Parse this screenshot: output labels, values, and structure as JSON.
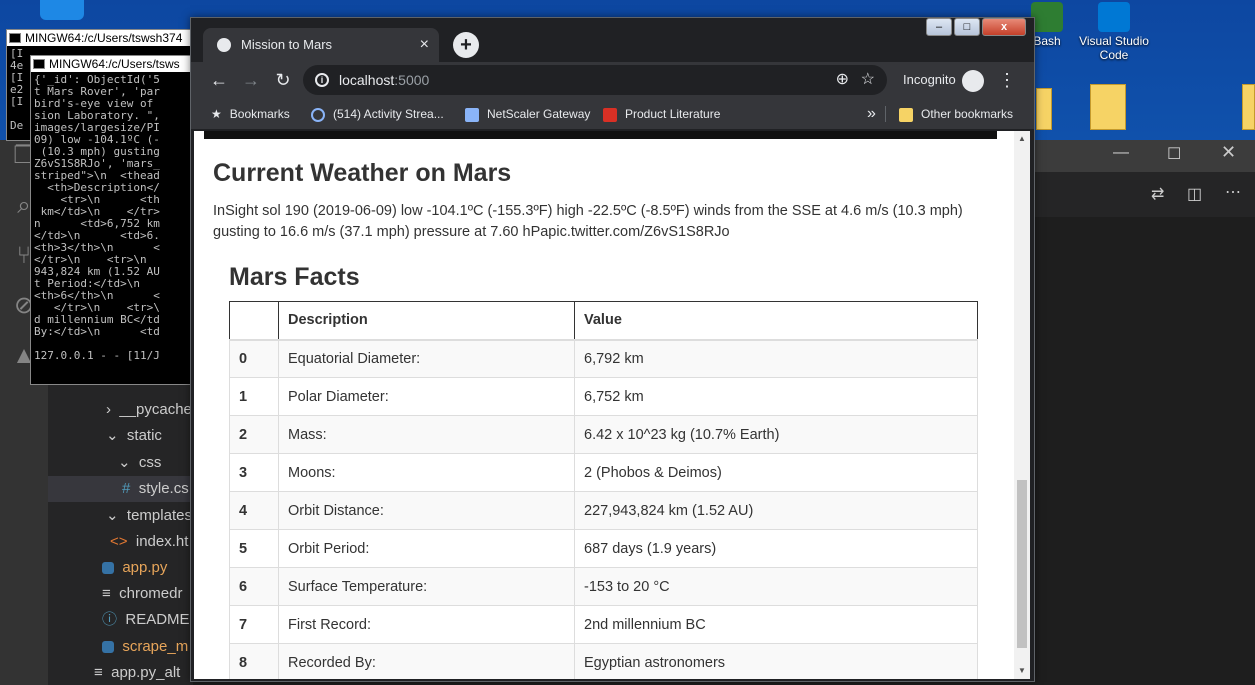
{
  "desktop": {
    "icons": [
      {
        "label": "Bash"
      },
      {
        "label": "Visual Studio Code"
      }
    ]
  },
  "terminals": {
    "back_title": "MINGW64:/c/Users/tswsh374",
    "front_title": "MINGW64:/c/Users/tsws",
    "back_left_lines": [
      "[I",
      "4e",
      "[I",
      "e2",
      "[I",
      "",
      "De"
    ],
    "front_lines": [
      "{'_id': ObjectId('5",
      "t Mars Rover', 'par",
      "bird's-eye view of",
      "sion Laboratory. \",",
      "images/largesize/PI",
      "09) low -104.1ºC (-",
      " (10.3 mph) gusting",
      "Z6vS1S8RJo', 'mars_",
      "striped\">\\n  <thead",
      "  <th>Description</",
      "    <tr>\\n      <th",
      " km</td>\\n    </tr>",
      "n      <td>6,752 km",
      "</td>\\n      <td>6.",
      "<th>3</th>\\n      <",
      "</tr>\\n    <tr>\\n",
      "943,824 km (1.52 AU",
      "t Period:</td>\\n",
      "<th>6</th>\\n      <",
      "   </tr>\\n    <tr>\\",
      "d millennium BC</td",
      "By:</td>\\n      <td",
      "",
      "127.0.0.1 - - [11/J"
    ]
  },
  "vscode": {
    "tree": [
      {
        "label": "__pycache",
        "prefix": "›"
      },
      {
        "label": "static",
        "prefix": "⌄"
      },
      {
        "label": "css",
        "prefix": "⌄"
      },
      {
        "label": "style.cs",
        "prefix": "#"
      },
      {
        "label": "templates",
        "prefix": "⌄"
      },
      {
        "label": "index.ht",
        "prefix": "<>"
      },
      {
        "label": "app.py",
        "prefix": ""
      },
      {
        "label": "chromedr",
        "prefix": "≡"
      },
      {
        "label": "README.",
        "prefix": "ⓘ"
      },
      {
        "label": "scrape_m",
        "prefix": ""
      },
      {
        "label": "app.py_alt",
        "prefix": "≡"
      }
    ]
  },
  "chrome": {
    "tab_title": "Mission to Mars",
    "tab_close": "×",
    "new_tab": "+",
    "window_buttons": {
      "minimize": "–",
      "maximize": "□",
      "close": "x"
    },
    "url_host": "localhost",
    "url_port": ":5000",
    "incognito_label": "Incognito",
    "bookmarks": [
      {
        "label": "Bookmarks",
        "color": "#e8eaed"
      },
      {
        "label": "(514) Activity Strea...",
        "color": "#8ab4f8"
      },
      {
        "label": "NetScaler Gateway",
        "color": "#8ab4f8"
      },
      {
        "label": "Product Literature",
        "color": "#d93025"
      }
    ],
    "bookmarks_overflow": "»",
    "other_bookmarks": "Other bookmarks"
  },
  "page": {
    "weather_title": "Current Weather on Mars",
    "weather_text": "InSight sol 190 (2019-06-09) low -104.1ºC (-155.3ºF) high -22.5ºC (-8.5ºF) winds from the SSE at 4.6 m/s (10.3 mph) gusting to 16.6 m/s (37.1 mph) pressure at 7.60 hPapic.twitter.com/Z6vS1S8RJo",
    "facts_title": "Mars Facts",
    "table": {
      "headers": [
        "",
        "Description",
        "Value"
      ],
      "rows": [
        {
          "idx": "0",
          "desc": "Equatorial Diameter:",
          "value": "6,792 km"
        },
        {
          "idx": "1",
          "desc": "Polar Diameter:",
          "value": "6,752 km"
        },
        {
          "idx": "2",
          "desc": "Mass:",
          "value": "6.42 x 10^23 kg (10.7% Earth)"
        },
        {
          "idx": "3",
          "desc": "Moons:",
          "value": "2 (Phobos & Deimos)"
        },
        {
          "idx": "4",
          "desc": "Orbit Distance:",
          "value": "227,943,824 km (1.52 AU)"
        },
        {
          "idx": "5",
          "desc": "Orbit Period:",
          "value": "687 days (1.9 years)"
        },
        {
          "idx": "6",
          "desc": "Surface Temperature:",
          "value": "-153 to 20 °C"
        },
        {
          "idx": "7",
          "desc": "First Record:",
          "value": "2nd millennium BC"
        },
        {
          "idx": "8",
          "desc": "Recorded By:",
          "value": "Egyptian astronomers"
        }
      ]
    }
  }
}
